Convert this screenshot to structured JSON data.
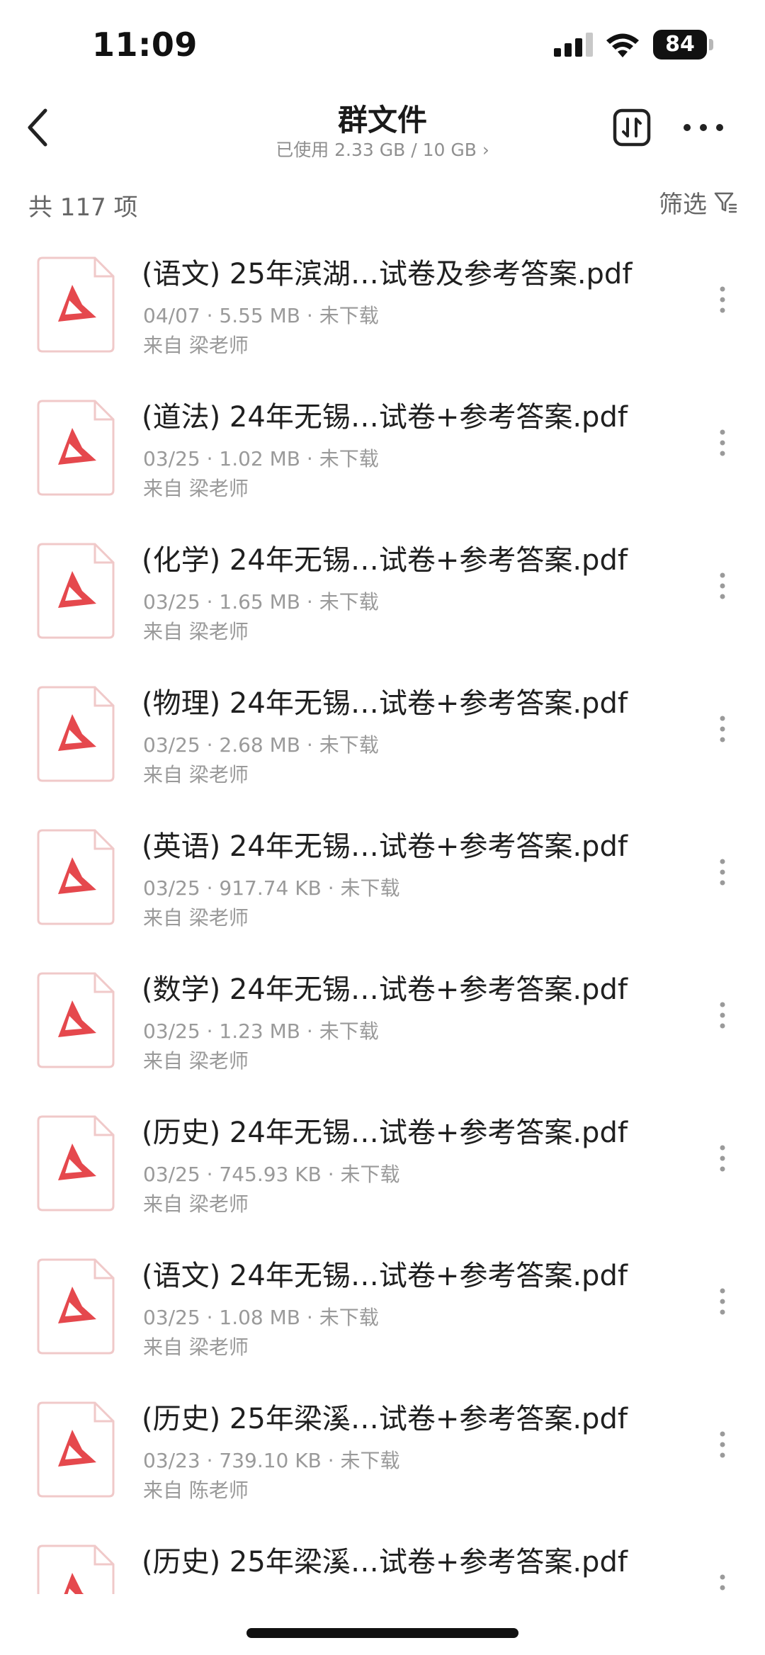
{
  "status_bar": {
    "time": "11:09",
    "battery": "84",
    "icons": [
      "cellular-signal-icon",
      "wifi-icon",
      "battery-icon"
    ]
  },
  "header": {
    "title": "群文件",
    "subtitle": "已使用 2.33 GB / 10 GB ›",
    "icons": [
      "back-chevron-icon",
      "sort-icon",
      "more-dots-icon"
    ]
  },
  "summary": {
    "count_label": "共 117 项",
    "filter_label": "筛选"
  },
  "colors": {
    "pdf_icon_red": "#e5484d",
    "pdf_icon_border": "#f0c9c9",
    "secondary_text": "#9a9a9a"
  },
  "files": [
    {
      "name": "(语文) 25年滨湖…试卷及参考答案.pdf",
      "meta": "04/07 · 5.55 MB · 未下载",
      "source": "来自 梁老师"
    },
    {
      "name": "(道法) 24年无锡…试卷+参考答案.pdf",
      "meta": "03/25 · 1.02 MB · 未下载",
      "source": "来自 梁老师"
    },
    {
      "name": "(化学) 24年无锡…试卷+参考答案.pdf",
      "meta": "03/25 · 1.65 MB · 未下载",
      "source": "来自 梁老师"
    },
    {
      "name": "(物理) 24年无锡…试卷+参考答案.pdf",
      "meta": "03/25 · 2.68 MB · 未下载",
      "source": "来自 梁老师"
    },
    {
      "name": "(英语) 24年无锡…试卷+参考答案.pdf",
      "meta": "03/25 · 917.74 KB · 未下载",
      "source": "来自 梁老师"
    },
    {
      "name": "(数学) 24年无锡…试卷+参考答案.pdf",
      "meta": "03/25 · 1.23 MB · 未下载",
      "source": "来自 梁老师"
    },
    {
      "name": "(历史) 24年无锡…试卷+参考答案.pdf",
      "meta": "03/25 · 745.93 KB · 未下载",
      "source": "来自 梁老师"
    },
    {
      "name": "(语文) 24年无锡…试卷+参考答案.pdf",
      "meta": "03/25 · 1.08 MB · 未下载",
      "source": "来自 梁老师"
    },
    {
      "name": "(历史) 25年梁溪…试卷+参考答案.pdf",
      "meta": "03/23 · 739.10 KB · 未下载",
      "source": "来自 陈老师"
    },
    {
      "name": "(历史) 25年梁溪…试卷+参考答案.pdf",
      "meta": "",
      "source": ""
    }
  ]
}
